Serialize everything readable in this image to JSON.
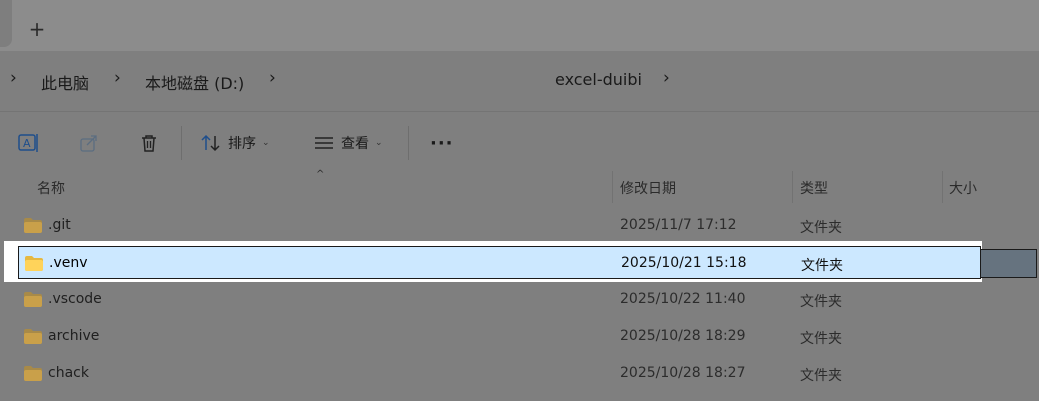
{
  "tabbar": {
    "new_tab_icon": "plus-icon"
  },
  "breadcrumb": {
    "items": [
      "此电脑",
      "本地磁盘 (D:)",
      "excel-duibi"
    ]
  },
  "toolbar": {
    "sort_label": "排序",
    "view_label": "查看",
    "more_label": "···"
  },
  "columns": {
    "name": "名称",
    "modified": "修改日期",
    "type": "类型",
    "size": "大小"
  },
  "rows": [
    {
      "name": ".git",
      "modified": "2025/11/7 17:12",
      "type": "文件夹",
      "selected": false
    },
    {
      "name": ".venv",
      "modified": "2025/10/21 15:18",
      "type": "文件夹",
      "selected": true
    },
    {
      "name": ".vscode",
      "modified": "2025/10/22 11:40",
      "type": "文件夹",
      "selected": false
    },
    {
      "name": "archive",
      "modified": "2025/10/28 18:29",
      "type": "文件夹",
      "selected": false
    },
    {
      "name": "chack",
      "modified": "2025/10/28 18:27",
      "type": "文件夹",
      "selected": false
    }
  ],
  "colors": {
    "selection": "#cce8ff",
    "folder": "#c9a04a",
    "folder_selected": "#ffd35a"
  }
}
